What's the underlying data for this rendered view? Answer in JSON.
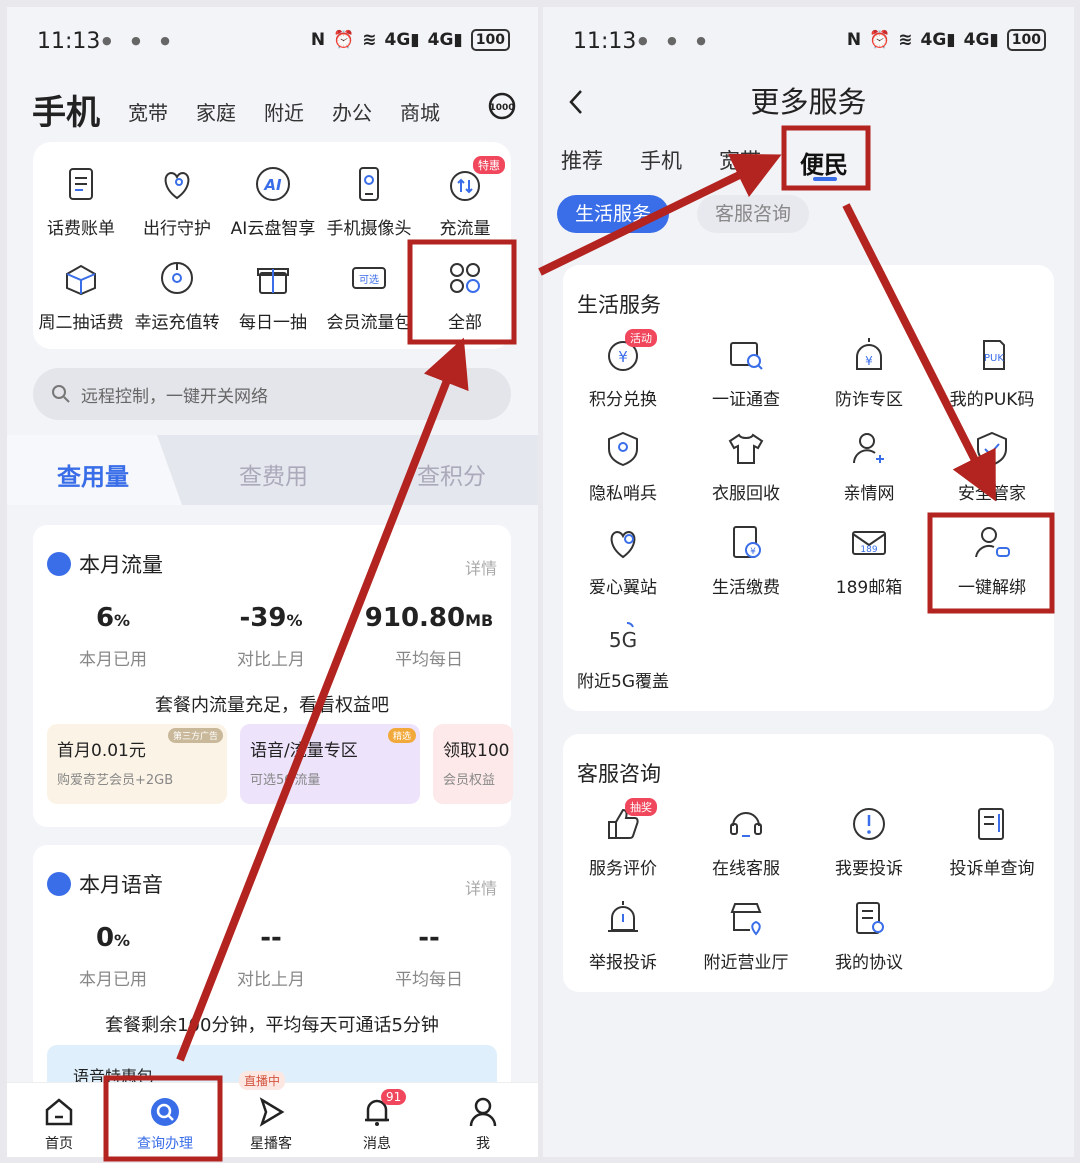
{
  "left": {
    "status": {
      "time": "11:13",
      "battery": "100"
    },
    "topnav": {
      "main": "手机",
      "items": [
        "宽带",
        "家庭",
        "附近",
        "办公",
        "商城"
      ]
    },
    "grid": [
      {
        "label": "话费账单",
        "icon": "bill-icon"
      },
      {
        "label": "出行守护",
        "icon": "heart-location-icon"
      },
      {
        "label": "AI云盘智享",
        "icon": "ai-icon"
      },
      {
        "label": "手机摄像头",
        "icon": "phone-camera-icon"
      },
      {
        "label": "充流量",
        "icon": "data-refill-icon",
        "tag": "特惠"
      },
      {
        "label": "周二抽话费",
        "icon": "box-icon"
      },
      {
        "label": "幸运充值转",
        "icon": "lucky-wheel-icon"
      },
      {
        "label": "每日一抽",
        "icon": "gift-icon"
      },
      {
        "label": "会员流量包",
        "icon": "optional-card-icon",
        "badge": "可选"
      },
      {
        "label": "全部",
        "icon": "all-grid-icon"
      }
    ],
    "search_placeholder": "远程控制，一键开关网络",
    "tabs": [
      "查用量",
      "查费用",
      "查积分"
    ],
    "traffic": {
      "title": "本月流量",
      "detail": "详情",
      "stats": [
        {
          "value": "6",
          "unit": "%",
          "label": "本月已用"
        },
        {
          "value": "-39",
          "unit": "%",
          "label": "对比上月"
        },
        {
          "value": "910.80",
          "unit": "MB",
          "label": "平均每日"
        }
      ],
      "note": "套餐内流量充足，看看权益吧",
      "promos": [
        {
          "title": "首月0.01元",
          "sub": "购爱奇艺会员+2GB",
          "tag": "第三方广告"
        },
        {
          "title": "语音/流量专区",
          "sub": "可选5G流量",
          "tag": "精选"
        },
        {
          "title": "领取100",
          "sub": "会员权益"
        }
      ]
    },
    "voice": {
      "title": "本月语音",
      "detail": "详情",
      "stats": [
        {
          "value": "0",
          "unit": "%",
          "label": "本月已用"
        },
        {
          "value": "--",
          "unit": "",
          "label": "对比上月"
        },
        {
          "value": "--",
          "unit": "",
          "label": "平均每日"
        }
      ],
      "note": "套餐剩余100分钟，平均每天可通话5分钟",
      "banner": "语音特惠包"
    },
    "live_tag": "直播中",
    "bottom": [
      {
        "label": "首页",
        "icon": "home-icon"
      },
      {
        "label": "查询办理",
        "icon": "query-icon"
      },
      {
        "label": "星播客",
        "icon": "play-icon"
      },
      {
        "label": "消息",
        "icon": "bell-icon",
        "badge": "91"
      },
      {
        "label": "我",
        "icon": "user-icon"
      }
    ]
  },
  "right": {
    "status": {
      "time": "11:13",
      "battery": "100"
    },
    "title": "更多服务",
    "tabs": [
      "推荐",
      "手机",
      "宽带",
      "便民"
    ],
    "chips": [
      "生活服务",
      "客服咨询"
    ],
    "life": {
      "title": "生活服务",
      "items": [
        {
          "label": "积分兑换",
          "icon": "points-exchange-icon",
          "tag": "活动"
        },
        {
          "label": "一证通查",
          "icon": "id-search-icon"
        },
        {
          "label": "防诈专区",
          "icon": "anti-fraud-icon"
        },
        {
          "label": "我的PUK码",
          "icon": "puk-icon"
        },
        {
          "label": "隐私哨兵",
          "icon": "privacy-shield-icon"
        },
        {
          "label": "衣服回收",
          "icon": "clothes-icon"
        },
        {
          "label": "亲情网",
          "icon": "family-icon"
        },
        {
          "label": "安全管家",
          "icon": "security-icon"
        },
        {
          "label": "爱心翼站",
          "icon": "love-station-icon"
        },
        {
          "label": "生活缴费",
          "icon": "payment-icon"
        },
        {
          "label": "189邮箱",
          "icon": "mail-icon"
        },
        {
          "label": "一键解绑",
          "icon": "unbind-icon"
        },
        {
          "label": "附近5G覆盖",
          "icon": "5g-icon"
        }
      ]
    },
    "service": {
      "title": "客服咨询",
      "items": [
        {
          "label": "服务评价",
          "icon": "rating-icon",
          "tag": "抽奖"
        },
        {
          "label": "在线客服",
          "icon": "headset-icon"
        },
        {
          "label": "我要投诉",
          "icon": "complaint-icon"
        },
        {
          "label": "投诉单查询",
          "icon": "complaint-query-icon"
        },
        {
          "label": "举报投诉",
          "icon": "alarm-icon"
        },
        {
          "label": "附近营业厅",
          "icon": "store-icon"
        },
        {
          "label": "我的协议",
          "icon": "agreement-icon"
        }
      ]
    }
  },
  "colors": {
    "accent": "#3a6ee8",
    "annotation": "#b3231f",
    "tag": "#f0475c"
  }
}
